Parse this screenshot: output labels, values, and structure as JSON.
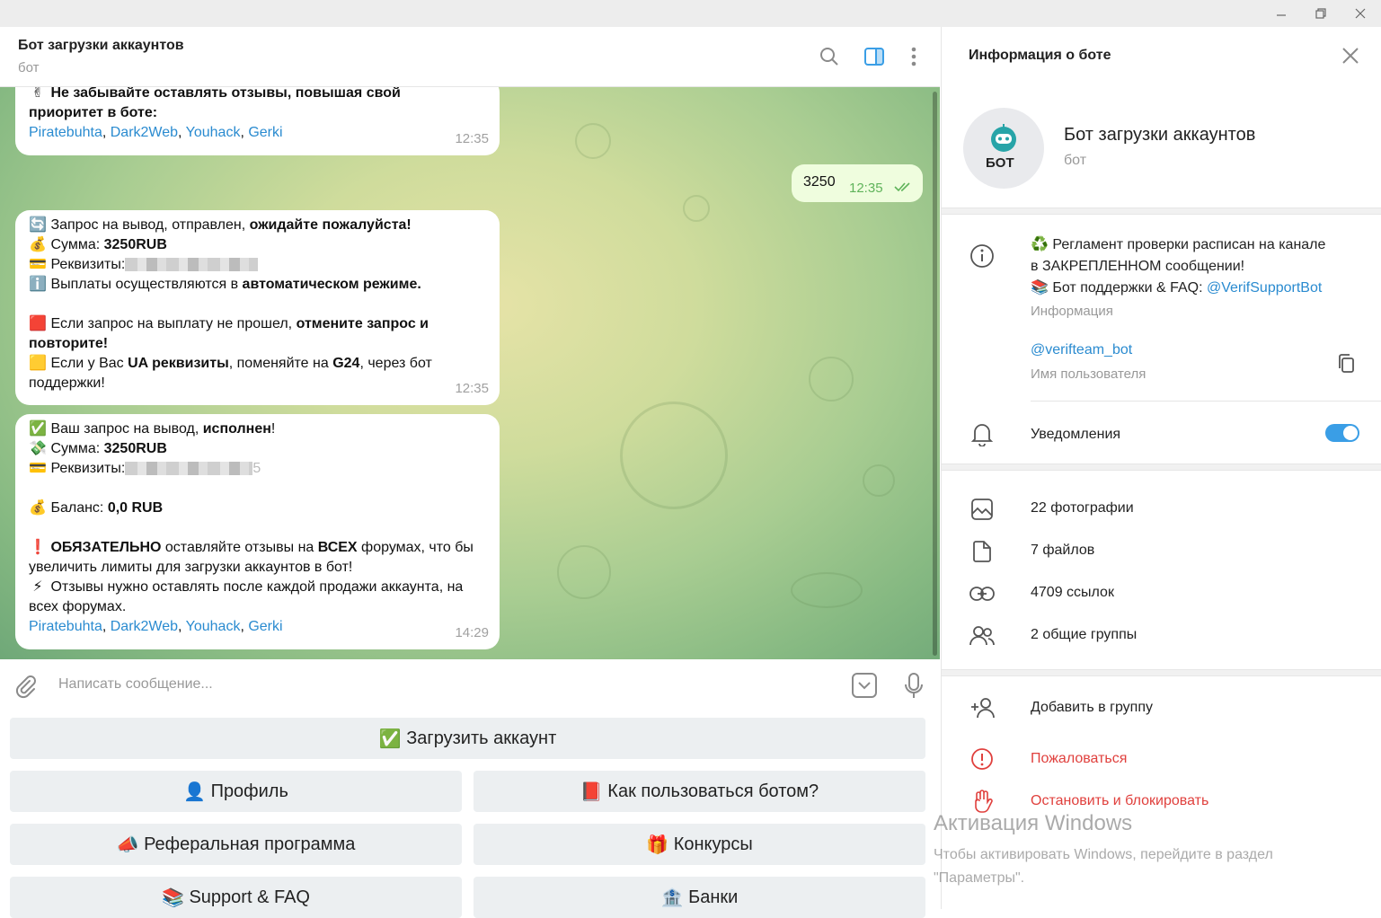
{
  "header": {
    "title": "Бот загрузки аккаунтов",
    "subtitle": "бот"
  },
  "messages": {
    "m1": {
      "line1": "Не забывайте оставлять отзывы, повышая свой",
      "line2": "приоритет в боте:",
      "links": [
        "Piratebuhta",
        "Dark2Web",
        "Youhack",
        "Gerki"
      ],
      "time": "12:35"
    },
    "outgoing": {
      "text": "3250",
      "time": "12:35"
    },
    "m2": {
      "l1a": "Запрос на вывод,  отправлен, ",
      "l1b": "ожидайте пожалуйста!",
      "l2a": "Сумма: ",
      "l2b": "3250RUB",
      "l3": "Реквизиты:",
      "l4a": "Выплаты осуществляются в ",
      "l4b": "автоматическом режиме.",
      "l5a": "Если запрос на выплату не прошел, ",
      "l5b": "отмените запрос и",
      "l6": "повторите!",
      "l7a": "Если у Вас ",
      "l7b": "UA реквизиты",
      "l7c": ", поменяйте на ",
      "l7d": "G24",
      "l7e": ", через бот",
      "l8": "поддержки!",
      "time": "12:35"
    },
    "m3": {
      "l1a": "Ваш запрос на вывод, ",
      "l1b": "исполнен",
      "l1c": "!",
      "l2a": "Сумма: ",
      "l2b": "3250RUB",
      "l3": "Реквизиты:",
      "l3tail": "5",
      "l4a": "Баланс: ",
      "l4b": "0,0 RUB",
      "l5a": "ОБЯЗАТЕЛЬНО",
      "l5b": " оставляйте отзывы на ",
      "l5c": "ВСЕХ",
      "l5d": " форумах, что бы",
      "l6": "увеличить лимиты для загрузки аккаунтов в бот!",
      "l7": "Отзывы нужно оставлять после каждой продажи аккаунта, на",
      "l8": "всех форумах.",
      "links": [
        "Piratebuhta",
        "Dark2Web",
        "Youhack",
        "Gerki"
      ],
      "time": "14:29"
    }
  },
  "input": {
    "placeholder": "Написать сообщение..."
  },
  "keyboard": {
    "upload": "Загрузить аккаунт",
    "profile": "Профиль",
    "howto": "Как пользоваться ботом?",
    "referral": "Реферальная программа",
    "contests": "Конкурсы",
    "support": "Support & FAQ",
    "banks": "Банки"
  },
  "panel": {
    "title": "Информация о боте",
    "avatar_text": "БОТ",
    "name": "Бот загрузки аккаунтов",
    "subtitle": "бот",
    "about_line1": "Регламент проверки расписан на канале",
    "about_line2": "в ЗАКРЕПЛЕННОМ сообщении!",
    "about_line3": "Бот поддержки & FAQ: ",
    "about_link": "@VerifSupportBot",
    "about_label": "Информация",
    "username": "@verifteam_bot",
    "username_label": "Имя пользователя",
    "notifications": "Уведомления",
    "notifications_on": true,
    "photos": "22 фотографии",
    "files": "7 файлов",
    "links": "4709 ссылок",
    "groups": "2 общие группы",
    "add_group": "Добавить в группу",
    "report": "Пожаловаться",
    "block": "Остановить и блокировать"
  },
  "watermark": {
    "title": "Активация Windows",
    "line1": "Чтобы активировать Windows, перейдите в раздел",
    "line2": "\"Параметры\"."
  },
  "colors": {
    "accent": "#3a9ee6",
    "link": "#2a8bd0",
    "danger": "#e0403d",
    "outgoing": "#effdde"
  }
}
